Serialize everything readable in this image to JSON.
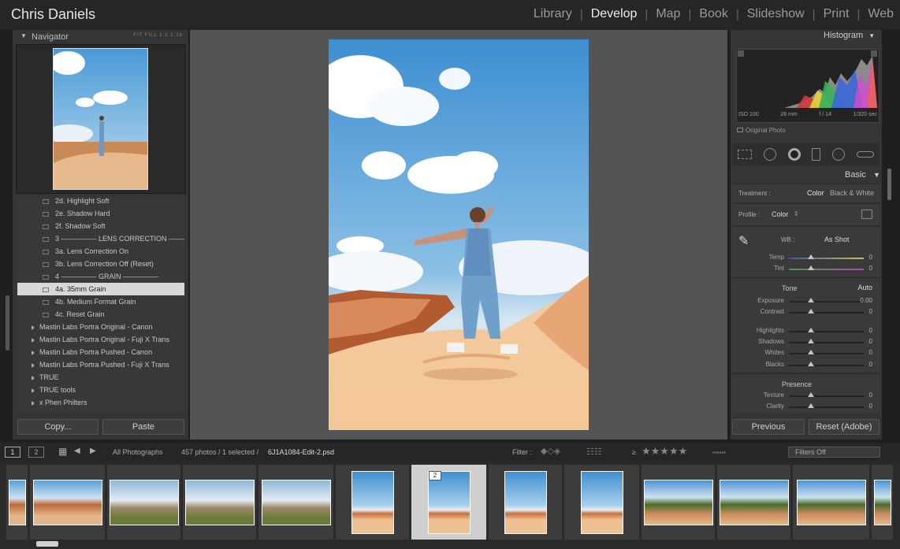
{
  "identity": "Chris Daniels",
  "modules": [
    "Library",
    "Develop",
    "Map",
    "Book",
    "Slideshow",
    "Print",
    "Web"
  ],
  "active_module": "Develop",
  "navigator": {
    "title": "Navigator",
    "zooms": "FIT  FILL  1:1  1:16"
  },
  "presets": [
    {
      "label": "2d. Highlight Soft",
      "kind": "item"
    },
    {
      "label": "2e. Shadow Hard",
      "kind": "item"
    },
    {
      "label": "2f. Shadow Soft",
      "kind": "item"
    },
    {
      "label": "3 ————— LENS CORRECTION —————",
      "kind": "item"
    },
    {
      "label": "3a. Lens Correction On",
      "kind": "item"
    },
    {
      "label": "3b. Lens Correction Off (Reset)",
      "kind": "item"
    },
    {
      "label": "4 ————— GRAIN —————",
      "kind": "item"
    },
    {
      "label": "4a. 35mm Grain",
      "kind": "selected"
    },
    {
      "label": "4b. Medium Format Grain",
      "kind": "item"
    },
    {
      "label": "4c. Reset Grain",
      "kind": "item"
    },
    {
      "label": "Mastin Labs Portra Original - Canon",
      "kind": "folder"
    },
    {
      "label": "Mastin Labs Portra Original - Fuji X Trans",
      "kind": "folder"
    },
    {
      "label": "Mastin Labs Portra Pushed - Canon",
      "kind": "folder"
    },
    {
      "label": "Mastin Labs Portra Pushed - Fuji X Trans",
      "kind": "folder"
    },
    {
      "label": "TRUE",
      "kind": "folder"
    },
    {
      "label": "TRUE tools",
      "kind": "folder"
    },
    {
      "label": "x   Phen Philters",
      "kind": "folder"
    }
  ],
  "buttons": {
    "copy": "Copy...",
    "paste": "Paste",
    "previous": "Previous",
    "reset": "Reset (Adobe)"
  },
  "histogram": {
    "title": "Histogram",
    "iso": "ISO 100",
    "focal": "28 mm",
    "aperture": "f / 14",
    "shutter": "1/320 sec",
    "original": "Original Photo"
  },
  "basic": {
    "title": "Basic",
    "treatment_label": "Treatment :",
    "treatment_color": "Color",
    "treatment_bw": "Black & White",
    "profile_label": "Profile :",
    "profile_value": "Color",
    "wb_label": "WB :",
    "wb_value": "As Shot",
    "tone_label": "Tone",
    "auto_label": "Auto",
    "presence_label": "Presence",
    "sliders": {
      "temp": {
        "label": "Temp",
        "value": "0"
      },
      "tint": {
        "label": "Tint",
        "value": "0"
      },
      "exposure": {
        "label": "Exposure",
        "value": "0.00"
      },
      "contrast": {
        "label": "Contrast",
        "value": "0"
      },
      "highlights": {
        "label": "Highlights",
        "value": "0"
      },
      "shadows": {
        "label": "Shadows",
        "value": "0"
      },
      "whites": {
        "label": "Whites",
        "value": "0"
      },
      "blacks": {
        "label": "Blacks",
        "value": "0"
      },
      "texture": {
        "label": "Texture",
        "value": "0"
      },
      "clarity": {
        "label": "Clarity",
        "value": "0"
      }
    }
  },
  "filter_bar": {
    "view1": "1",
    "view2": "2",
    "source": "All Photographs",
    "count": "457 photos / 1 selected /",
    "filename": "6J1A1084-Edit-2.psd",
    "filter_label": "Filter :",
    "rating_op": "≥",
    "filters_off": "Filters Off"
  },
  "filmstrip": {
    "selected_badge": "2"
  },
  "colors": {
    "accent_text": "#ededed",
    "panel": "#353535",
    "canvas": "#545454"
  }
}
